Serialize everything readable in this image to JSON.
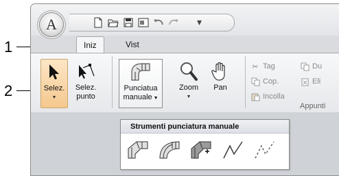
{
  "callouts": {
    "one": "1",
    "two": "2"
  },
  "app_button": {
    "letter": "A"
  },
  "tabs": [
    {
      "label": "Iniz"
    },
    {
      "label": "Vist"
    }
  ],
  "ribbon": {
    "select_label": "Selez.",
    "select_point_label_1": "Selez.",
    "select_point_label_2": "punto",
    "manual_punch_label_1": "Punciatua",
    "manual_punch_label_2": "manuale",
    "zoom_label": "Zoom",
    "pan_label": "Pan",
    "clipboard": {
      "cut_label": "Tag",
      "copy_label": "Cop.",
      "paste_label": "Incolla",
      "duplicate_label": "Du",
      "delete_label": "Eli",
      "group_label": "Appunti"
    }
  },
  "dropdown": {
    "title": "Strumenti punciatura manuale"
  },
  "colors": {
    "ribbon_bg": "#e9ebee",
    "window_border": "#8c8c8c",
    "accent": "#f3c99b"
  }
}
